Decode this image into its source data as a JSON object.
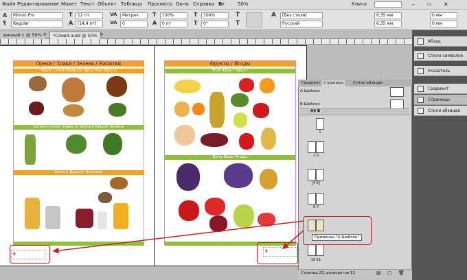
{
  "menu": [
    "Файл",
    "Редактирование",
    "Макет",
    "Текст",
    "Объект",
    "Таблица",
    "Просмотр",
    "Окно",
    "Справка"
  ],
  "zoom_menu": "50%",
  "workspace": "Книга",
  "control": {
    "font_family": "Minion Pro",
    "font_style": "Regular",
    "font_size": "12 пт",
    "leading": "(14,4 пт)",
    "kerning": "Метрич.",
    "tracking": "0",
    "scale_v": "100%",
    "scale_h": "100%",
    "baseline": "0 пт",
    "skew": "0°",
    "para_style": "[Без стиля]",
    "language": "Русский",
    "indent_1": "6,35 мм",
    "indent_2": "6,35 мм",
    "space_1": "0 мм",
    "space_2": "0 мм"
  },
  "tabs": [
    "занный-1 @ 50%",
    "*Слов4.indd @ 50%"
  ],
  "left_page": {
    "title": "Орехи / Злаки / Зелень / Напитки",
    "bar1": "Фрукт Эсим Фийд Ба Фрут Мук Фрути",
    "bar2": "Cereals Cereal Злаки & Verdure Вишни Зелень",
    "bar3": "Bevero Ддрент Напитки",
    "page_number": "8"
  },
  "right_page": {
    "title": "Фрукты / Ягоды",
    "bar1": "Fruit Фрукт Фрукт",
    "bar2": "Berry Беро Ягоды",
    "page_number": "9"
  },
  "pages_panel": {
    "tabs": [
      "Градиент",
      "Страницы",
      "Стили абзацев"
    ],
    "master_a": "А-Шаблон",
    "master_b": "В-Шаблон",
    "selector": "А4 В",
    "pages": [
      "1",
      "2-3",
      "[4-5]",
      "6-7",
      "",
      "10-11"
    ],
    "tooltip": "Применен \"А-Шаблон\"",
    "status": "Страниц 23, разворотов 12"
  },
  "dock": [
    "Абзац",
    "Стили символов",
    "Указатель",
    "Градиент",
    "Страницы",
    "Стили абзацев"
  ],
  "accent": "#f2a21c",
  "green": "#8fc23a"
}
